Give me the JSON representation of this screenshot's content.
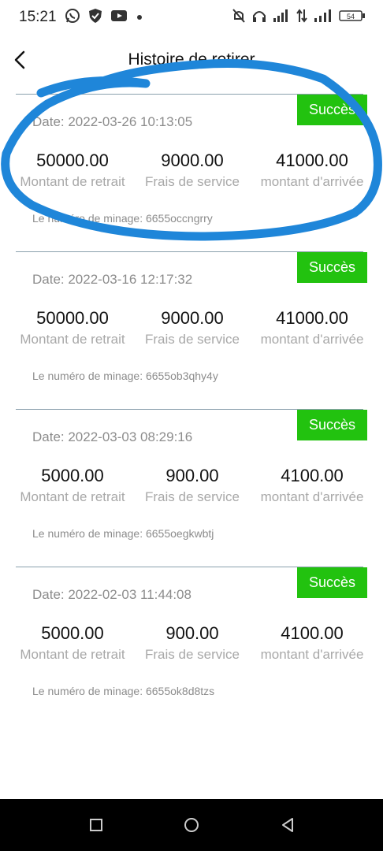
{
  "status_bar": {
    "time": "15:21",
    "battery": "54",
    "left_icons": [
      "whatsapp-icon",
      "shield-icon",
      "youtube-icon",
      "dot-icon"
    ],
    "right_icons": [
      "mute-icon",
      "headphones-icon",
      "signal-icon",
      "data-transfer-icon",
      "hplus-signal-icon",
      "battery-icon"
    ]
  },
  "header": {
    "title": "Histoire de retirer"
  },
  "labels": {
    "withdraw_amount": "Montant de retrait",
    "service_fee": "Frais de service",
    "arrival_amount": "montant d'arrivée"
  },
  "records": [
    {
      "status": "Succès",
      "date": "Date: 2022-03-26 10:13:05",
      "withdraw": "50000.00",
      "fee": "9000.00",
      "arrival": "41000.00",
      "mining": "Le numéro de minage: 6655occngrry"
    },
    {
      "status": "Succès",
      "date": "Date: 2022-03-16 12:17:32",
      "withdraw": "50000.00",
      "fee": "9000.00",
      "arrival": "41000.00",
      "mining": "Le numéro de minage: 6655ob3qhy4y"
    },
    {
      "status": "Succès",
      "date": "Date: 2022-03-03 08:29:16",
      "withdraw": "5000.00",
      "fee": "900.00",
      "arrival": "4100.00",
      "mining": "Le numéro de minage: 6655oegkwbtj"
    },
    {
      "status": "Succès",
      "date": "Date: 2022-02-03 11:44:08",
      "withdraw": "5000.00",
      "fee": "900.00",
      "arrival": "4100.00",
      "mining": "Le numéro de minage: 6655ok8d8tzs"
    }
  ],
  "colors": {
    "success_badge": "#22c20f",
    "annotation_stroke": "#1f86d9",
    "divider": "#8aa0ad"
  }
}
